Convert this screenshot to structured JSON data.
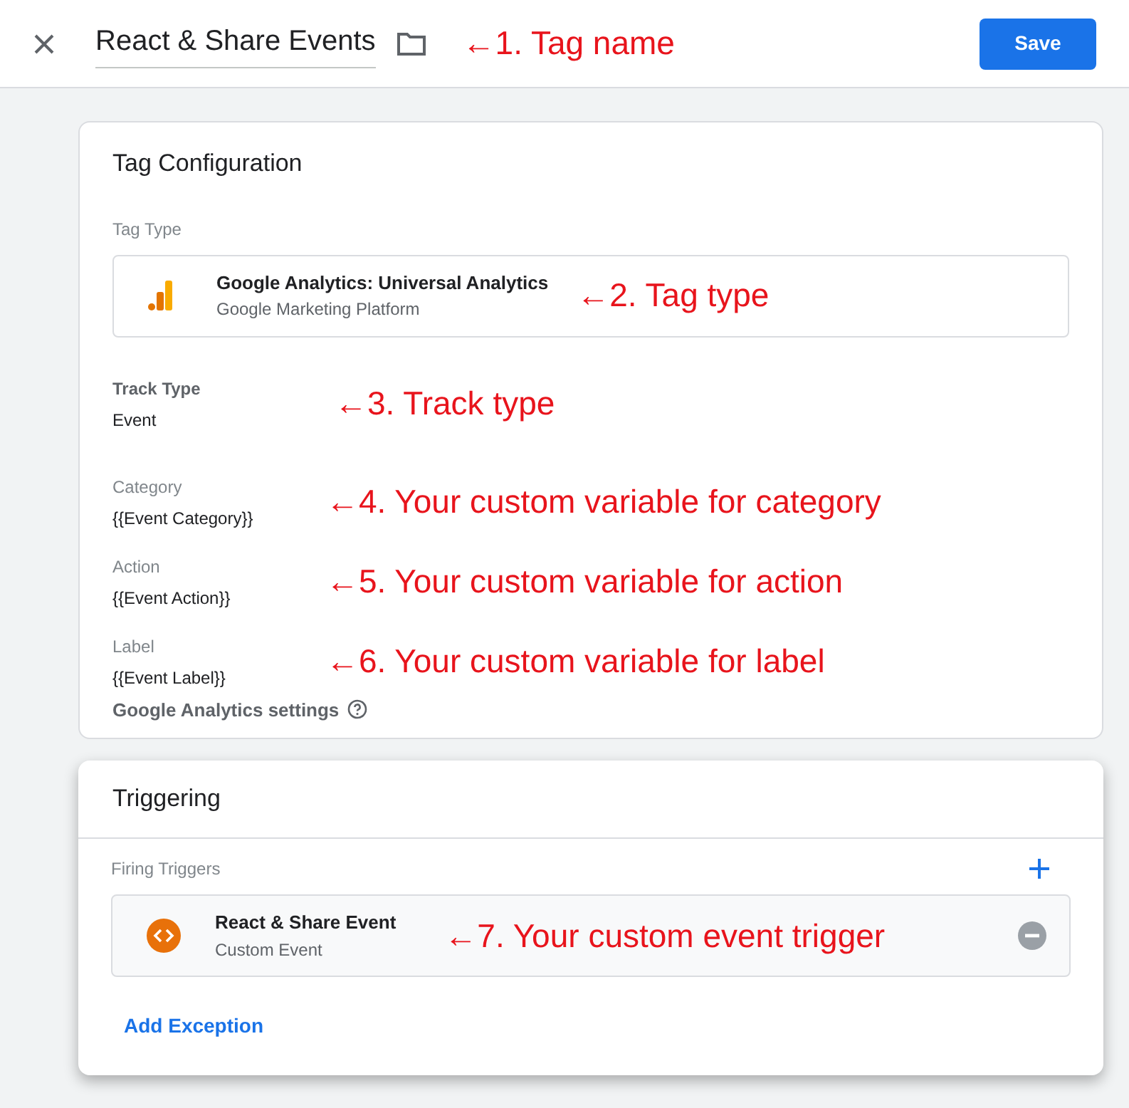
{
  "header": {
    "tag_name": "React & Share Events",
    "annotation": "←1. Tag name",
    "save_button": "Save"
  },
  "tag_configuration": {
    "title": "Tag Configuration",
    "tag_type_label": "Tag Type",
    "tag_type": {
      "name": "Google Analytics: Universal Analytics",
      "provider": "Google Marketing Platform",
      "annotation": "←2. Tag type"
    },
    "fields": [
      {
        "kind": "emphasized",
        "label": "Track Type",
        "value": "Event",
        "annotation": "←3. Track type"
      },
      {
        "kind": "plain",
        "label": "Category",
        "value": "{{Event Category}}",
        "annotation": "←4. Your custom variable for category"
      },
      {
        "kind": "plain",
        "label": "Action",
        "value": "{{Event Action}}",
        "annotation": "←5. Your custom variable for action"
      },
      {
        "kind": "plain",
        "label": "Label",
        "value": "{{Event Label}}",
        "annotation": "←6. Your custom variable for label"
      }
    ],
    "settings_link": "Google Analytics settings"
  },
  "triggering": {
    "title": "Triggering",
    "firing_label": "Firing Triggers",
    "triggers": [
      {
        "name": "React & Share Event",
        "type": "Custom Event",
        "annotation": "←7. Your custom event trigger"
      }
    ],
    "add_exception": "Add Exception"
  }
}
